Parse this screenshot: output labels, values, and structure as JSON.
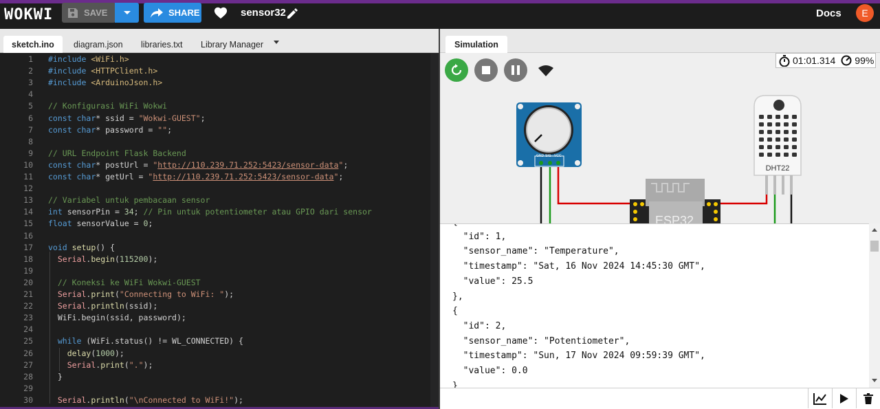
{
  "app": {
    "logo": "WOKWI",
    "save_label": "SAVE",
    "share_label": "SHARE",
    "project_name": "sensor32",
    "docs_label": "Docs",
    "avatar_letter": "E"
  },
  "editor_tabs": [
    {
      "label": "sketch.ino",
      "active": true
    },
    {
      "label": "diagram.json",
      "active": false
    },
    {
      "label": "libraries.txt",
      "active": false
    },
    {
      "label": "Library Manager",
      "active": false
    }
  ],
  "code_lines": [
    {
      "n": "1",
      "segs": [
        [
          "#include ",
          "inc"
        ],
        [
          "<WiFi.h>",
          "hdr"
        ]
      ]
    },
    {
      "n": "2",
      "segs": [
        [
          "#include ",
          "inc"
        ],
        [
          "<HTTPClient.h>",
          "hdr"
        ]
      ]
    },
    {
      "n": "3",
      "segs": [
        [
          "#include ",
          "inc"
        ],
        [
          "<ArduinoJson.h>",
          "hdr"
        ]
      ]
    },
    {
      "n": "4",
      "segs": []
    },
    {
      "n": "5",
      "segs": [
        [
          "// Konfigurasi WiFi Wokwi",
          "cmt"
        ]
      ]
    },
    {
      "n": "6",
      "segs": [
        [
          "const ",
          "kw"
        ],
        [
          "char",
          "kw"
        ],
        [
          "* ssid = ",
          "pl"
        ],
        [
          "\"Wokwi-GUEST\"",
          "str"
        ],
        [
          ";",
          "pl"
        ]
      ]
    },
    {
      "n": "7",
      "segs": [
        [
          "const ",
          "kw"
        ],
        [
          "char",
          "kw"
        ],
        [
          "* password = ",
          "pl"
        ],
        [
          "\"\"",
          "str"
        ],
        [
          ";",
          "pl"
        ]
      ]
    },
    {
      "n": "8",
      "segs": []
    },
    {
      "n": "9",
      "segs": [
        [
          "// URL Endpoint Flask Backend",
          "cmt"
        ]
      ]
    },
    {
      "n": "10",
      "segs": [
        [
          "const ",
          "kw"
        ],
        [
          "char",
          "kw"
        ],
        [
          "* postUrl = ",
          "pl"
        ],
        [
          "\"",
          "str"
        ],
        [
          "http://110.239.71.252:5423/sensor-data",
          "url"
        ],
        [
          "\"",
          "str"
        ],
        [
          ";",
          "pl"
        ]
      ]
    },
    {
      "n": "11",
      "segs": [
        [
          "const ",
          "kw"
        ],
        [
          "char",
          "kw"
        ],
        [
          "* getUrl = ",
          "pl"
        ],
        [
          "\"",
          "str"
        ],
        [
          "http://110.239.71.252:5423/sensor-data",
          "url"
        ],
        [
          "\"",
          "str"
        ],
        [
          ";",
          "pl"
        ]
      ]
    },
    {
      "n": "12",
      "segs": []
    },
    {
      "n": "13",
      "segs": [
        [
          "// Variabel untuk pembacaan sensor",
          "cmt"
        ]
      ]
    },
    {
      "n": "14",
      "segs": [
        [
          "int ",
          "kw"
        ],
        [
          "sensorPin = ",
          "pl"
        ],
        [
          "34",
          "num"
        ],
        [
          "; ",
          "pl"
        ],
        [
          "// Pin untuk potentiometer atau GPIO dari sensor",
          "cmt"
        ]
      ]
    },
    {
      "n": "15",
      "segs": [
        [
          "float ",
          "kw"
        ],
        [
          "sensorValue = ",
          "pl"
        ],
        [
          "0",
          "num"
        ],
        [
          ";",
          "pl"
        ]
      ]
    },
    {
      "n": "16",
      "segs": []
    },
    {
      "n": "17",
      "segs": [
        [
          "void ",
          "kw"
        ],
        [
          "setup",
          "fn"
        ],
        [
          "() {",
          "pl"
        ]
      ]
    },
    {
      "n": "18",
      "segs": [
        [
          "  ",
          "pl"
        ],
        [
          "Serial",
          "obj"
        ],
        [
          ".",
          "pl"
        ],
        [
          "begin",
          "fn"
        ],
        [
          "(",
          "pl"
        ],
        [
          "115200",
          "num"
        ],
        [
          ");",
          "pl"
        ]
      ]
    },
    {
      "n": "19",
      "segs": []
    },
    {
      "n": "20",
      "segs": [
        [
          "  ",
          "pl"
        ],
        [
          "// Koneksi ke WiFi Wokwi-GUEST",
          "cmt"
        ]
      ]
    },
    {
      "n": "21",
      "segs": [
        [
          "  ",
          "pl"
        ],
        [
          "Serial",
          "obj"
        ],
        [
          ".",
          "pl"
        ],
        [
          "print",
          "fn"
        ],
        [
          "(",
          "pl"
        ],
        [
          "\"Connecting to WiFi: \"",
          "str"
        ],
        [
          ");",
          "pl"
        ]
      ]
    },
    {
      "n": "22",
      "segs": [
        [
          "  ",
          "pl"
        ],
        [
          "Serial",
          "obj"
        ],
        [
          ".",
          "pl"
        ],
        [
          "println",
          "fn"
        ],
        [
          "(ssid);",
          "pl"
        ]
      ]
    },
    {
      "n": "23",
      "segs": [
        [
          "  WiFi.",
          "pl"
        ],
        [
          "begin",
          "pl"
        ],
        [
          "(ssid, password);",
          "pl"
        ]
      ]
    },
    {
      "n": "24",
      "segs": []
    },
    {
      "n": "25",
      "segs": [
        [
          "  ",
          "pl"
        ],
        [
          "while",
          "kw"
        ],
        [
          " (WiFi.",
          "pl"
        ],
        [
          "status",
          "pl"
        ],
        [
          "() != WL_CONNECTED) {",
          "pl"
        ]
      ]
    },
    {
      "n": "26",
      "segs": [
        [
          "    ",
          "pl"
        ],
        [
          "delay",
          "fn"
        ],
        [
          "(",
          "pl"
        ],
        [
          "1000",
          "num"
        ],
        [
          ");",
          "pl"
        ]
      ]
    },
    {
      "n": "27",
      "segs": [
        [
          "    ",
          "pl"
        ],
        [
          "Serial",
          "obj"
        ],
        [
          ".",
          "pl"
        ],
        [
          "print",
          "fn"
        ],
        [
          "(",
          "pl"
        ],
        [
          "\".\"",
          "str"
        ],
        [
          ");",
          "pl"
        ]
      ]
    },
    {
      "n": "28",
      "segs": [
        [
          "  }",
          "pl"
        ]
      ]
    },
    {
      "n": "29",
      "segs": []
    },
    {
      "n": "30",
      "segs": [
        [
          "  ",
          "pl"
        ],
        [
          "Serial",
          "obj"
        ],
        [
          ".",
          "pl"
        ],
        [
          "println",
          "fn"
        ],
        [
          "(",
          "pl"
        ],
        [
          "\"\\nConnected to WiFi!\"",
          "str"
        ],
        [
          ");",
          "pl"
        ]
      ]
    }
  ],
  "syntax_colors": {
    "inc": "#569cd6",
    "hdr": "#d7ba7d",
    "cmt": "#6a9955",
    "kw": "#569cd6",
    "pl": "#d4d4d4",
    "str": "#ce9178",
    "url": "#ce9178",
    "num": "#b5cea8",
    "fn": "#dcdcaa",
    "obj": "#f0a0a0"
  },
  "simulation": {
    "tab_label": "Simulation",
    "timer": "01:01.314",
    "speed": "99%",
    "dht_label": "DHT22",
    "esp_label": "ESP32",
    "pot_pins": [
      "GND",
      "SIG",
      "VCC"
    ]
  },
  "serial_lines": [
    "{",
    "  \"id\": 1,",
    "  \"sensor_name\": \"Temperature\",",
    "  \"timestamp\": \"Sat, 16 Nov 2024 14:45:30 GMT\",",
    "  \"value\": 25.5",
    "},",
    "{",
    "  \"id\": 2,",
    "  \"sensor_name\": \"Potentiometer\",",
    "  \"timestamp\": \"Sun, 17 Nov 2024 09:59:39 GMT\",",
    "  \"value\": 0.0",
    "}"
  ]
}
